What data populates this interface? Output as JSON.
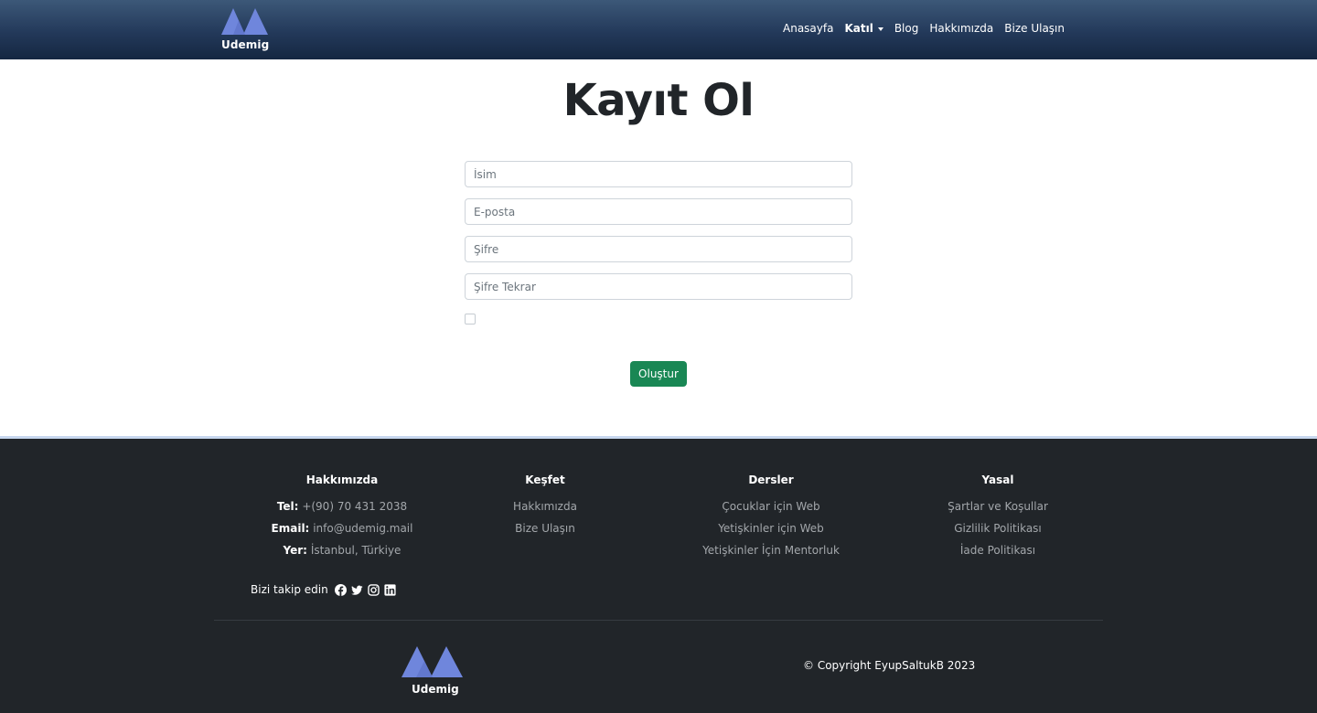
{
  "brand": {
    "name": "Udemig",
    "logo_color": "#6f86dc"
  },
  "nav": {
    "items": [
      {
        "label": "Anasayfa"
      },
      {
        "label": "Katıl",
        "active": true,
        "dropdown": true
      },
      {
        "label": "Blog"
      },
      {
        "label": "Hakkımızda"
      },
      {
        "label": "Bize Ulaşın"
      }
    ]
  },
  "form": {
    "title": "Kayıt Ol",
    "name_placeholder": "İsim",
    "email_placeholder": "E-posta",
    "password_placeholder": "Şifre",
    "password_repeat_placeholder": "Şifre Tekrar",
    "checkbox_checked": false,
    "submit_label": "Oluştur",
    "submit_color": "#198754"
  },
  "footer": {
    "about": {
      "title": "Hakkımızda",
      "tel_label": "Tel:",
      "tel_value": "+(90) 70 431 2038",
      "email_label": "Email:",
      "email_value": "info@udemig.mail",
      "location_label": "Yer:",
      "location_value": "İstanbul, Türkiye",
      "follow_label": "Bizi takip edin",
      "social_icons": [
        "facebook-icon",
        "twitter-icon",
        "instagram-icon",
        "linkedin-icon"
      ]
    },
    "discover": {
      "title": "Keşfet",
      "links": [
        "Hakkımızda",
        "Bize Ulaşın"
      ]
    },
    "courses": {
      "title": "Dersler",
      "links": [
        "Çocuklar için Web",
        "Yetişkinler için Web",
        "Yetişkinler İçin Mentorluk"
      ]
    },
    "legal": {
      "title": "Yasal",
      "links": [
        "Şartlar ve Koşullar",
        "Gizlilik Politikası",
        "İade Politikası"
      ]
    },
    "copyright": "© Copyright EyupSaltukB 2023",
    "background": "#212529"
  }
}
